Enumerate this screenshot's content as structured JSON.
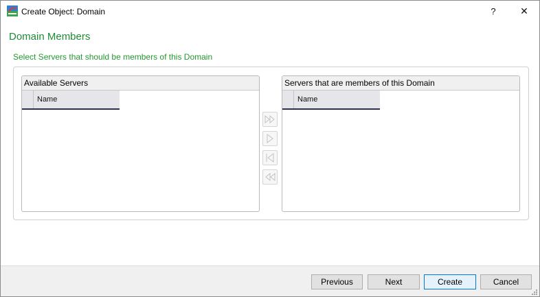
{
  "window": {
    "title": "Create Object: Domain",
    "help_label": "?",
    "close_label": "✕"
  },
  "page": {
    "heading": "Domain Members",
    "subheading": "Select Servers that should be members of this Domain"
  },
  "available_panel": {
    "title": "Available Servers",
    "columns": [
      "Name"
    ]
  },
  "members_panel": {
    "title": "Servers that are members of this Domain",
    "columns": [
      "Name"
    ]
  },
  "move_buttons": [
    "add-all-icon",
    "add-selected-icon",
    "remove-selected-icon",
    "remove-all-icon"
  ],
  "footer": {
    "previous": "Previous",
    "next": "Next",
    "create": "Create",
    "cancel": "Cancel"
  },
  "colors": {
    "heading": "#1e8b37",
    "subheading": "#22992f",
    "primary_border": "#0078d7"
  }
}
